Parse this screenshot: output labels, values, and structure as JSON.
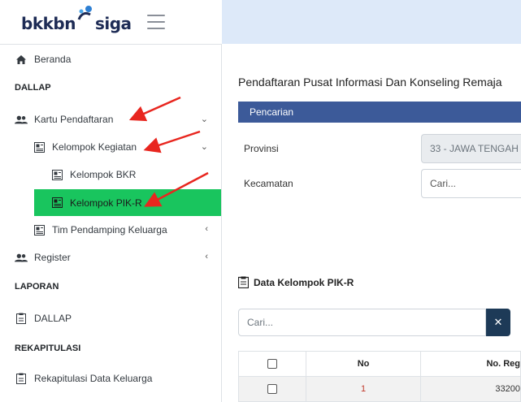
{
  "brand": {
    "text_left": "bkkbn",
    "text_right": "siga"
  },
  "sidebar": {
    "items": [
      {
        "label": "Beranda"
      },
      {
        "label": "Kartu Pendaftaran"
      },
      {
        "label": "Kelompok Kegiatan"
      },
      {
        "label": "Kelompok BKR"
      },
      {
        "label": "Kelompok PIK-R"
      },
      {
        "label": "Tim Pendamping Keluarga"
      },
      {
        "label": "Register"
      },
      {
        "label": "DALLAP"
      },
      {
        "label": "Rekapitulasi Data Keluarga"
      }
    ],
    "headers": {
      "dallap": "DALLAP",
      "laporan": "LAPORAN",
      "rekapitulasi": "REKAPITULASI"
    }
  },
  "main": {
    "title": "Pendaftaran Pusat Informasi Dan Konseling Remaja",
    "search_panel": {
      "title": "Pencarian"
    },
    "fields": {
      "provinsi": {
        "label": "Provinsi",
        "value": "33 - JAWA TENGAH"
      },
      "kecamatan": {
        "label": "Kecamatan",
        "placeholder": "Cari..."
      }
    },
    "data_section": {
      "title": "Data Kelompok PIK-R"
    },
    "search": {
      "placeholder": "Cari..."
    },
    "table": {
      "headers": [
        "",
        "No",
        "No. Reg"
      ],
      "rows": [
        {
          "no": "1",
          "reg": "33200"
        }
      ]
    }
  },
  "colors": {
    "active": "#19c55e",
    "panel_header": "#3c5a99",
    "search_button": "#1d3a57",
    "arrow": "#e8261f"
  }
}
